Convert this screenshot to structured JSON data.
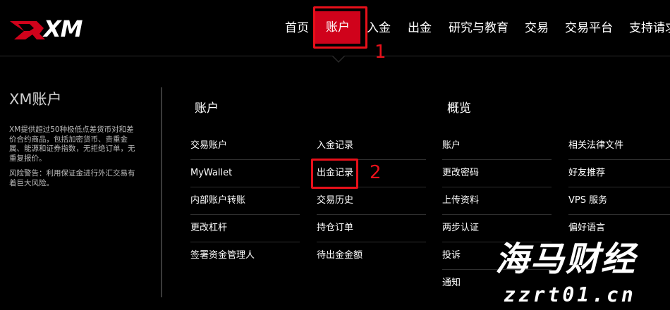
{
  "brand": {
    "logo_text": "XM",
    "accent": "#d0021b",
    "annotation_color": "#e8101a"
  },
  "nav": {
    "items": [
      {
        "label": "首页"
      },
      {
        "label": "账户",
        "active": true
      },
      {
        "label": "入金"
      },
      {
        "label": "出金"
      },
      {
        "label": "研究与教育"
      },
      {
        "label": "交易"
      },
      {
        "label": "交易平台"
      },
      {
        "label": "支持请求"
      }
    ]
  },
  "info": {
    "title": "XM账户",
    "description": "XM提供超过50种极低点差货币对和差价合约商品，包括加密货币、贵重金属、能源和证券指数，无拒绝订单，无重复报价。",
    "risk_warning": "风险警告：利用保证金进行外汇交易有着巨大风险。"
  },
  "sections": {
    "account_title": "账户",
    "overview_title": "概览"
  },
  "columns": {
    "col1": [
      "交易账户",
      "MyWallet",
      "内部账户转账",
      "更改杠杆",
      "签署资金管理人"
    ],
    "col2": [
      "入金记录",
      "出金记录",
      "交易历史",
      "持仓订单",
      "待出金金额"
    ],
    "col3": [
      "账户",
      "更改密码",
      "上传资料",
      "两步认证",
      "投诉",
      "通知"
    ],
    "col4": [
      "相关法律文件",
      "好友推荐",
      "VPS 服务",
      "偏好语言"
    ]
  },
  "annotations": {
    "step1": "1",
    "step2": "2"
  },
  "watermark": {
    "main": "海马财经",
    "sub": "zzrt01.cn"
  }
}
